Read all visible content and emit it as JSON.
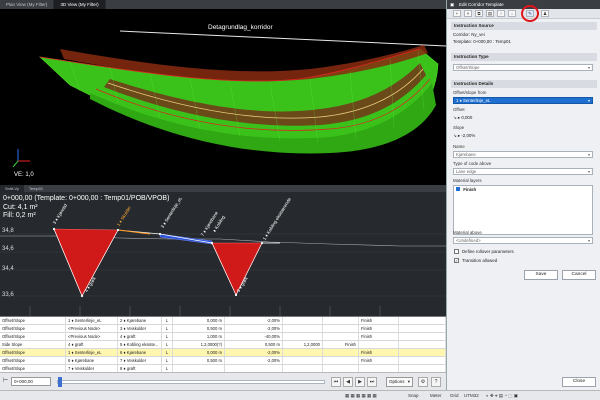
{
  "tabs": [
    {
      "label": "Plan View (My Filter)"
    },
    {
      "label": "3D View (My Filter)"
    }
  ],
  "view3d": {
    "corridor_label": "Detagrundlag_korridor",
    "ve_label": "VE: 1,0"
  },
  "cross_tabs": [
    {
      "label": "Snitt-Vy"
    },
    {
      "label": "Temp01"
    }
  ],
  "cross_section": {
    "station_line": "0+000,00 (Template: 0+000,00 : Temp01/POB/VPOB)",
    "cut": "Cut: 4,1 m²",
    "fill": "Fill: 0,2 m²",
    "y_ticks": [
      "34,8",
      "34,6",
      "34,4",
      "33,6"
    ],
    "code_labels": [
      {
        "text": "3 ♦ Kjøretid"
      },
      {
        "text": "4 ♦ grøft"
      },
      {
        "text": "1 ♦ Skulder"
      },
      {
        "text": "3 ♦ Senterlinje_eL"
      },
      {
        "text": "7 ♦ Kjørebane"
      },
      {
        "text": "♦ Kobling"
      },
      {
        "text": "5 ♦ grøft"
      },
      {
        "text": "1 ♦ Kobling eksisterende"
      }
    ]
  },
  "table": {
    "rows": [
      {
        "cells": [
          "Offset/Slope",
          "1 ♦ Senterlinje_eL",
          "2 ♦ Kjørebane",
          "L",
          "0,000 m",
          "-2,00%",
          "",
          "",
          "Finish",
          ""
        ],
        "selected": false
      },
      {
        "cells": [
          "Offset/Slope",
          "<Previous Node>",
          "3 ♦ Veiskulder",
          "L",
          "0,500 m",
          "-2,00%",
          "",
          "",
          "Finish",
          ""
        ],
        "selected": false
      },
      {
        "cells": [
          "Offset/Slope",
          "<Previous Node>",
          "4 ♦ grøft",
          "L",
          "1,000 m",
          "-40,00%",
          "",
          "",
          "Finish",
          ""
        ],
        "selected": false
      },
      {
        "cells": [
          "Side Slope",
          "4 ♦ grøft",
          "5 ♦ Kobling eksiste...",
          "L",
          "1,2,0000(?)",
          "0,500 m",
          "1,2,0000",
          "Finish",
          "",
          ""
        ],
        "selected": false
      },
      {
        "cells": [
          "Offset/Slope",
          "1 ♦ Senterlinje_eL",
          "6 ♦ Kjørebane",
          "L",
          "0,000 m",
          "-2,00%",
          "",
          "",
          "Finish",
          ""
        ],
        "selected": true
      },
      {
        "cells": [
          "Offset/Slope",
          "6 ♦ Kjørebane",
          "7 ♦ Veiskulder",
          "L",
          "0,500 m",
          "-2,00%",
          "",
          "",
          "Finish",
          ""
        ],
        "selected": false
      },
      {
        "cells": [
          "Offset/Slope",
          "7 ♦ Veiskulder",
          "8 ♦ grøft",
          "L",
          "",
          "",
          "",
          "",
          "",
          ""
        ],
        "selected": false
      }
    ]
  },
  "bottombar": {
    "station_value": "0+000,00",
    "options_label": "Options"
  },
  "panel": {
    "title": "Edit Corridor Template",
    "instruction_source_header": "Instruction Source",
    "corridor_text": "Corridor: Ny_vei",
    "template_text": "Template: 0+000,00 : Temp01",
    "instruction_type_header": "Instruction Type",
    "instruction_type_value": "Offset/Slope",
    "instruction_details_header": "Instruction Details",
    "offset_from_label": "Offset/slope from",
    "offset_from_value": "1 ♦ Senterlinje_eL",
    "offset_label": "Offset",
    "offset_value": "0,000",
    "slope_label": "Slope",
    "slope_value": "-2,00%",
    "name_label": "Name",
    "name_value": "Kjørebane",
    "code_type_label": "Type of code above",
    "code_type_value": "Lane edge",
    "material_layers_label": "Material layers",
    "material_item": "Finish",
    "material_above_label": "Material above",
    "material_above_value": "<Undefined>",
    "define_rollover_label": "Define rollover parameters",
    "transition_allowed_label": "Transition allowed",
    "save_label": "Save",
    "cancel_label": "Cancel",
    "close_label": "Close"
  },
  "statusbar": {
    "snap": "Snap",
    "units": "Meter",
    "grid": "Grid",
    "coords": "UTM32"
  },
  "colors": {
    "cut_fill": "#d01a1a",
    "fill_fill": "#2a52d8",
    "corridor_green": "#3bc21a",
    "highlight_circle": "#e0141b"
  }
}
